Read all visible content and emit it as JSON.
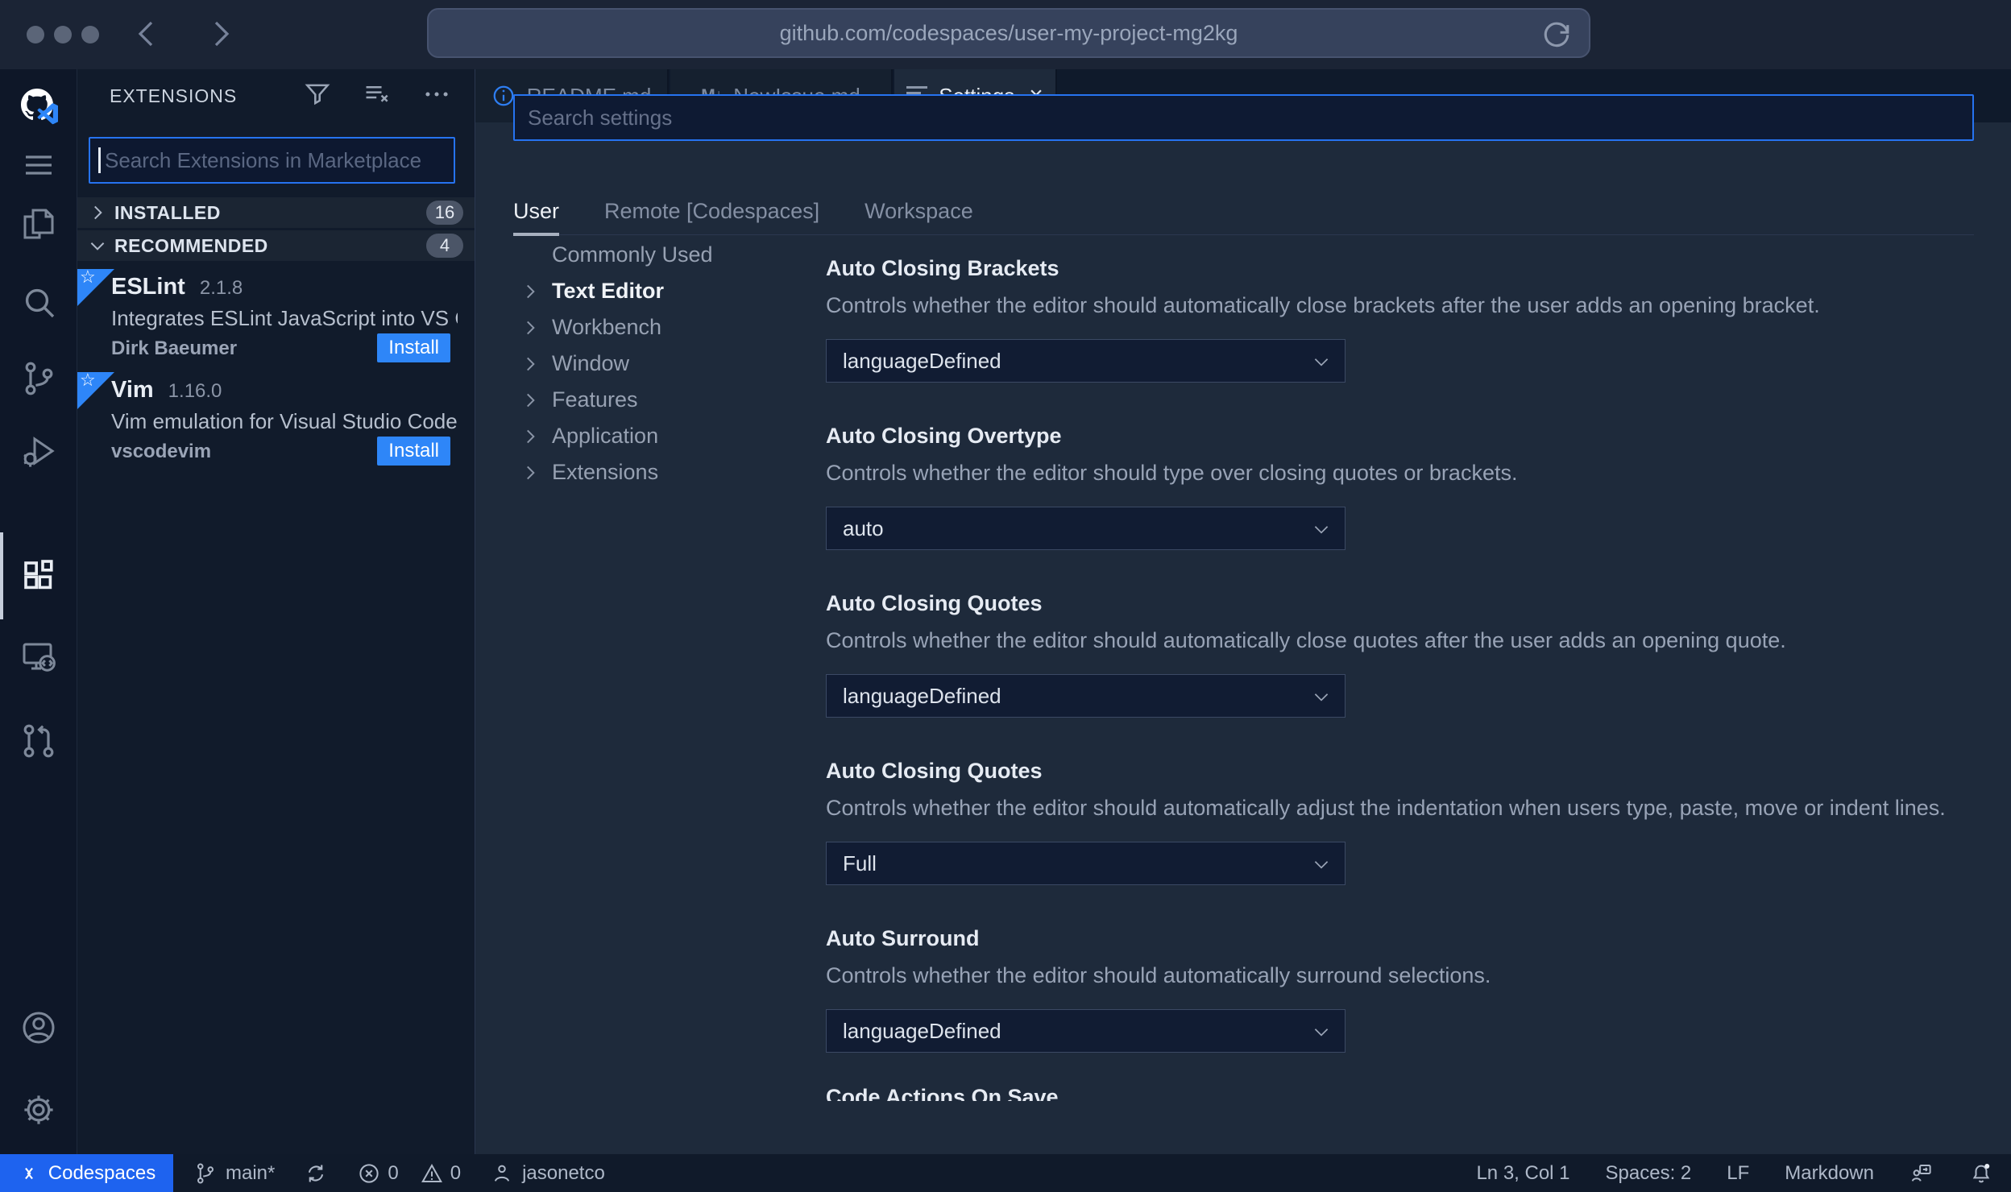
{
  "browser": {
    "url": "github.com/codespaces/user-my-project-mg2kg"
  },
  "sidebar": {
    "title": "EXTENSIONS",
    "search_placeholder": "Search Extensions in Marketplace",
    "sections": [
      {
        "label": "INSTALLED",
        "count": "16"
      },
      {
        "label": "RECOMMENDED",
        "count": "4"
      }
    ],
    "extensions": [
      {
        "name": "ESLint",
        "version": "2.1.8",
        "description": "Integrates ESLint JavaScript into VS C...",
        "author": "Dirk Baeumer",
        "action": "Install"
      },
      {
        "name": "Vim",
        "version": "1.16.0",
        "description": "Vim emulation for Visual Studio Code...",
        "author": "vscodevim",
        "action": "Install"
      }
    ],
    "ribbon_star": "☆"
  },
  "tabs": {
    "items": [
      {
        "label": "README.md"
      },
      {
        "label": "NewIssue.md",
        "icon_glyph": "M↓"
      },
      {
        "label": "Settings",
        "close": "×"
      }
    ]
  },
  "settings": {
    "search_placeholder": "Search settings",
    "scopes": [
      {
        "label": "User"
      },
      {
        "label": "Remote [Codespaces]"
      },
      {
        "label": "Workspace"
      }
    ],
    "tree": [
      {
        "label": "Commonly Used"
      },
      {
        "label": "Text Editor"
      },
      {
        "label": "Workbench"
      },
      {
        "label": "Window"
      },
      {
        "label": "Features"
      },
      {
        "label": "Application"
      },
      {
        "label": "Extensions"
      }
    ],
    "rows": [
      {
        "title": "Auto Closing Brackets",
        "description": "Controls whether the editor should automatically close brackets after the user adds an opening bracket.",
        "value": "languageDefined"
      },
      {
        "title": "Auto Closing Overtype",
        "description": "Controls whether the editor should type over closing quotes or brackets.",
        "value": "auto"
      },
      {
        "title": "Auto Closing Quotes",
        "description": "Controls whether the editor should automatically close quotes after the user adds an opening quote.",
        "value": "languageDefined"
      },
      {
        "title": "Auto Closing Quotes",
        "description": "Controls whether the editor should automatically adjust the indentation when users type, paste, move or indent lines.",
        "value": "Full"
      },
      {
        "title": "Auto Surround",
        "description": "Controls whether the editor should automatically surround selections.",
        "value": "languageDefined"
      },
      {
        "title": "Code Actions On Save",
        "description": "",
        "value": ""
      }
    ]
  },
  "status_bar": {
    "codespaces": "Codespaces",
    "branch": "main*",
    "errors": "0",
    "warnings": "0",
    "user": "jasonetco",
    "cursor": "Ln 3, Col 1",
    "indent": "Spaces: 2",
    "eol": "LF",
    "language": "Markdown"
  },
  "colors": {
    "accent_blue": "#2e86f8",
    "focus_border": "#2673f0",
    "codespaces_blue": "#1e63ef",
    "editor_bg": "#1e2a3b",
    "sidebar_bg": "#111b2b",
    "activity_bg": "#0e1728",
    "chrome_bg": "#1b2435",
    "status_bg": "#101a2a"
  }
}
